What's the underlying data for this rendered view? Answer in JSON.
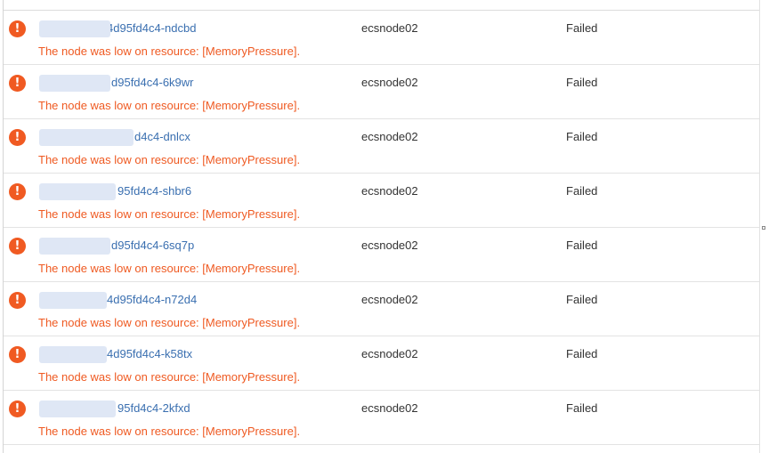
{
  "events": [
    {
      "pod_name": "4d95fd4c4-ndcbd",
      "message": "The node was low on resource: [MemoryPressure].",
      "node": "ecsnode02",
      "status": "Failed",
      "icon": "exclamation-circle-icon"
    },
    {
      "pod_name": "d95fd4c4-6k9wr",
      "message": "The node was low on resource: [MemoryPressure].",
      "node": "ecsnode02",
      "status": "Failed",
      "icon": "exclamation-circle-icon"
    },
    {
      "pod_name": "d4c4-dnlcx",
      "message": "The node was low on resource: [MemoryPressure].",
      "node": "ecsnode02",
      "status": "Failed",
      "icon": "exclamation-circle-icon"
    },
    {
      "pod_name": "95fd4c4-shbr6",
      "message": "The node was low on resource: [MemoryPressure].",
      "node": "ecsnode02",
      "status": "Failed",
      "icon": "exclamation-circle-icon"
    },
    {
      "pod_name": "d95fd4c4-6sq7p",
      "message": "The node was low on resource: [MemoryPressure].",
      "node": "ecsnode02",
      "status": "Failed",
      "icon": "exclamation-circle-icon"
    },
    {
      "pod_name": "4d95fd4c4-n72d4",
      "message": "The node was low on resource: [MemoryPressure].",
      "node": "ecsnode02",
      "status": "Failed",
      "icon": "exclamation-circle-icon"
    },
    {
      "pod_name": "4d95fd4c4-k58tx",
      "message": "The node was low on resource: [MemoryPressure].",
      "node": "ecsnode02",
      "status": "Failed",
      "icon": "exclamation-circle-icon"
    },
    {
      "pod_name": "95fd4c4-2kfxd",
      "message": "The node was low on resource: [MemoryPressure].",
      "node": "ecsnode02",
      "status": "Failed",
      "icon": "exclamation-circle-icon"
    }
  ],
  "colors": {
    "error_accent": "#f05a22",
    "link": "#3a6fb0",
    "text": "#333333",
    "divider": "#e3e3e3"
  }
}
